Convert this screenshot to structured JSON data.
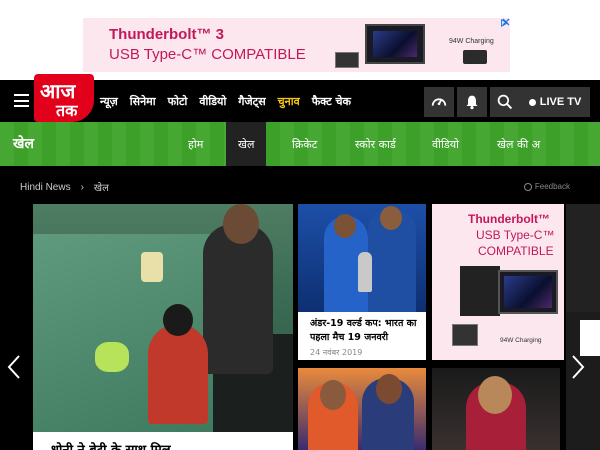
{
  "ad_banner": {
    "line1": "Thunderbolt™ 3",
    "line2": "USB Type-C™ COMPATIBLE",
    "charging_label": "94W Charging",
    "adchoices_icon": "adchoices-icon",
    "close_icon": "close-icon"
  },
  "header": {
    "menu_icon": "hamburger-icon",
    "logo_line1": "आज",
    "logo_line2": "तक",
    "nav": [
      {
        "label": "न्यूज़"
      },
      {
        "label": "सिनेमा"
      },
      {
        "label": "फोटो"
      },
      {
        "label": "वीडियो"
      },
      {
        "label": "गैजेट्स"
      },
      {
        "label": "चुनाव",
        "highlight": true
      },
      {
        "label": "फैक्ट चेक"
      }
    ],
    "icons": [
      "speedometer-icon",
      "bell-icon",
      "search-icon"
    ],
    "live_label": "LIVE TV"
  },
  "section_bar": {
    "title": "खेल",
    "tabs": [
      "होम",
      "खेल",
      "क्रिकेट",
      "स्कोर कार्ड",
      "वीडियो",
      "खेल की अ"
    ],
    "active_tab": "खेल",
    "accent_color": "#3fa52a"
  },
  "breadcrumb": {
    "items": [
      "Hindi News",
      "खेल"
    ],
    "separator": "›",
    "feedback_label": "Feedback"
  },
  "cards": {
    "featured_caption": "धोनी ने बेटी के साथ मिल",
    "card1_title": "अंडर-19 वर्ल्ड कप: भारत का पहला मैच 19 जनवरी",
    "card1_date": "24 नवंबर 2019",
    "ad2_line1": "Thunderbolt™",
    "ad2_line2": "USB Type-C™",
    "ad2_line3": "COMPATIBLE",
    "ad2_charging": "94W Charging"
  },
  "carousel": {
    "prev_icon": "chevron-left-icon",
    "next_icon": "chevron-right-icon"
  }
}
